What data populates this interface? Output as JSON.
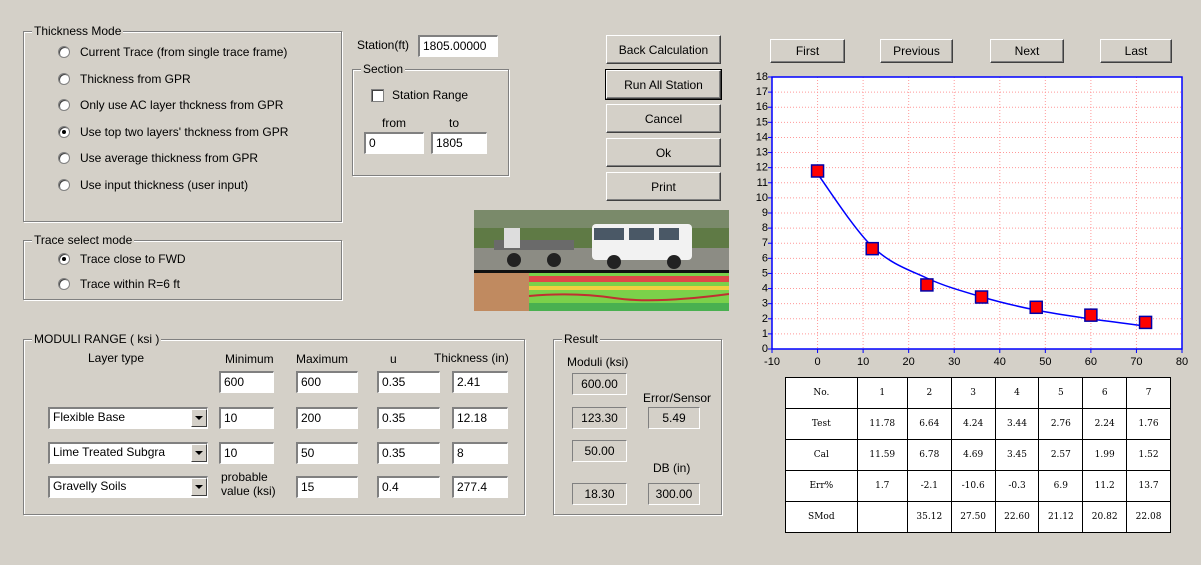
{
  "thickness_mode": {
    "title": "Thickness Mode",
    "options": [
      {
        "label": "Current Trace (from single trace frame)",
        "selected": false
      },
      {
        "label": "Thickness from GPR",
        "selected": false
      },
      {
        "label": "Only use AC layer thckness from GPR",
        "selected": false
      },
      {
        "label": "Use top two layers' thckness from GPR",
        "selected": true
      },
      {
        "label": "Use average thickness from GPR",
        "selected": false
      },
      {
        "label": "Use input thickness (user input)",
        "selected": false
      }
    ]
  },
  "station": {
    "label": "Station(ft)",
    "value": "1805.00000"
  },
  "section": {
    "title": "Section",
    "station_range_label": "Station Range",
    "station_range_checked": false,
    "from_label": "from",
    "to_label": "to",
    "from_value": "0",
    "to_value": "1805"
  },
  "actions": {
    "back_calculation": "Back Calculation",
    "run_all_station": "Run All Station",
    "cancel": "Cancel",
    "ok": "Ok",
    "print": "Print"
  },
  "nav": {
    "first": "First",
    "previous": "Previous",
    "next": "Next",
    "last": "Last"
  },
  "trace_select": {
    "title": "Trace select mode",
    "options": [
      {
        "label": "Trace close to FWD",
        "selected": true
      },
      {
        "label": "Trace within R=6 ft",
        "selected": false
      }
    ]
  },
  "moduli_range": {
    "title": "MODULI  RANGE   ( ksi )",
    "headers": {
      "layer_type": "Layer type",
      "minimum": "Minimum",
      "maximum": "Maximum",
      "u": "u",
      "thickness": "Thickness (in)"
    },
    "rows": [
      {
        "layer": "",
        "minimum": "600",
        "maximum": "600",
        "u": "0.35",
        "thickness": "2.41"
      },
      {
        "layer": "Flexible Base",
        "minimum": "10",
        "maximum": "200",
        "u": "0.35",
        "thickness": "12.18"
      },
      {
        "layer": "Lime Treated Subgra",
        "minimum": "10",
        "maximum": "50",
        "u": "0.35",
        "thickness": "8"
      },
      {
        "layer": "Gravelly Soils",
        "minimum": "probable\nvalue (ksi)",
        "maximum": "15",
        "u": "0.4",
        "thickness": "277.4"
      }
    ]
  },
  "result": {
    "title": "Result",
    "moduli_label": "Moduli (ksi)",
    "moduli": [
      "600.00",
      "123.30",
      "50.00",
      "18.30"
    ],
    "error_label": "Error/Sensor",
    "error_value": "5.49",
    "db_label": "DB (in)",
    "db_value": "300.00"
  },
  "table": {
    "columns": [
      "No.",
      "1",
      "2",
      "3",
      "4",
      "5",
      "6",
      "7"
    ],
    "rows": [
      [
        "Test",
        "11.78",
        "6.64",
        "4.24",
        "3.44",
        "2.76",
        "2.24",
        "1.76"
      ],
      [
        "Cal",
        "11.59",
        "6.78",
        "4.69",
        "3.45",
        "2.57",
        "1.99",
        "1.52"
      ],
      [
        "Err%",
        "1.7",
        "-2.1",
        "-10.6",
        "-0.3",
        "6.9",
        "11.2",
        "13.7"
      ],
      [
        "SMod",
        "",
        "35.12",
        "27.50",
        "22.60",
        "21.12",
        "20.82",
        "22.08"
      ]
    ]
  },
  "chart_data": {
    "type": "scatter",
    "x": [
      0,
      12,
      24,
      36,
      48,
      60,
      72
    ],
    "series": [
      {
        "values": [
          11.78,
          6.64,
          4.24,
          3.44,
          2.76,
          2.24,
          1.76
        ],
        "marker": "square"
      },
      {
        "values": [
          11.59,
          6.78,
          4.69,
          3.45,
          2.57,
          1.99,
          1.52
        ],
        "style": "line"
      }
    ],
    "xlim": [
      -10,
      80
    ],
    "ylim": [
      0,
      18
    ],
    "xticks": [
      "-10",
      "0",
      "10",
      "20",
      "30",
      "40",
      "50",
      "60",
      "70",
      "80"
    ],
    "yticks": [
      "0",
      "1",
      "2",
      "3",
      "4",
      "5",
      "6",
      "7",
      "8",
      "9",
      "10",
      "11",
      "12",
      "13",
      "14",
      "15",
      "16",
      "17",
      "18"
    ],
    "grid": true,
    "colors": {
      "line": "#0000ff",
      "marker_fill": "#ff0000",
      "axis": "#0000ff",
      "grid": "#ff9999"
    }
  }
}
